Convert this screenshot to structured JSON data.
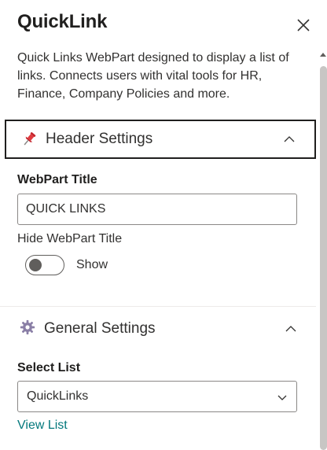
{
  "panel": {
    "title": "QuickLink",
    "description": "Quick Links WebPart designed to display a list of links. Connects users with vital tools for HR, Finance, Company Policies and more."
  },
  "header_settings": {
    "label": "Header Settings",
    "icon": "pushpin-icon",
    "expanded": true,
    "webpart_title_label": "WebPart Title",
    "webpart_title_value": "QUICK LINKS",
    "hide_title_label": "Hide WebPart Title",
    "toggle_text": "Show",
    "toggle_on": false
  },
  "general_settings": {
    "label": "General Settings",
    "icon": "gear-icon",
    "expanded": true,
    "select_list_label": "Select List",
    "selected_list": "QuickLinks",
    "view_list_link": "View List"
  },
  "colors": {
    "link": "#03787c",
    "pin": "#e03a3e"
  }
}
